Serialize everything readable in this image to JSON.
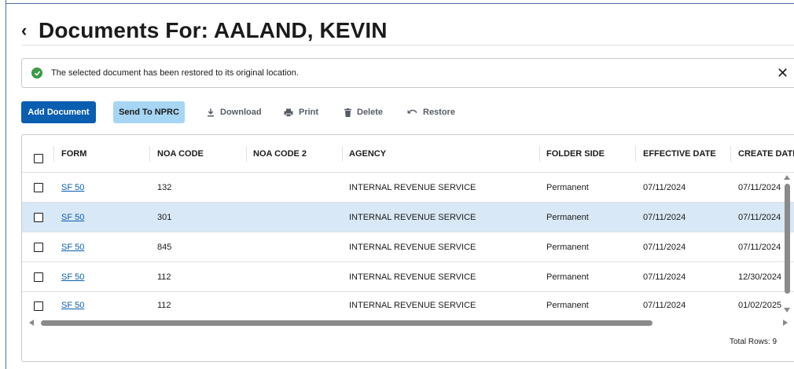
{
  "page": {
    "back_glyph": "‹",
    "title": "Documents For: AALAND, KEVIN"
  },
  "alert": {
    "message": "The selected document has been restored to its original location.",
    "close_glyph": "✕",
    "status_color": "#3a9a46"
  },
  "toolbar": {
    "add_document": "Add Document",
    "send_to_nprc": "Send To NPRC",
    "download": "Download",
    "print": "Print",
    "delete": "Delete",
    "restore": "Restore"
  },
  "table": {
    "columns": [
      "FORM",
      "NOA CODE",
      "NOA CODE 2",
      "AGENCY",
      "FOLDER SIDE",
      "EFFECTIVE DATE",
      "CREATE DATE"
    ],
    "rows": [
      {
        "form": "SF 50",
        "noa_code": "132",
        "noa_code_2": "",
        "agency": "INTERNAL REVENUE SERVICE",
        "folder_side": "Permanent",
        "effective_date": "07/11/2024",
        "create_date": "07/11/2024",
        "selected": false
      },
      {
        "form": "SF 50",
        "noa_code": "301",
        "noa_code_2": "",
        "agency": "INTERNAL REVENUE SERVICE",
        "folder_side": "Permanent",
        "effective_date": "07/11/2024",
        "create_date": "07/11/2024",
        "selected": true
      },
      {
        "form": "SF 50",
        "noa_code": "845",
        "noa_code_2": "",
        "agency": "INTERNAL REVENUE SERVICE",
        "folder_side": "Permanent",
        "effective_date": "07/11/2024",
        "create_date": "07/11/2024",
        "selected": false
      },
      {
        "form": "SF 50",
        "noa_code": "112",
        "noa_code_2": "",
        "agency": "INTERNAL REVENUE SERVICE",
        "folder_side": "Permanent",
        "effective_date": "07/11/2024",
        "create_date": "12/30/2024",
        "selected": false
      },
      {
        "form": "SF 50",
        "noa_code": "112",
        "noa_code_2": "",
        "agency": "INTERNAL REVENUE SERVICE",
        "folder_side": "Permanent",
        "effective_date": "07/11/2024",
        "create_date": "01/02/2025",
        "selected": false
      }
    ],
    "total_rows": "Total Rows: 9"
  },
  "colors": {
    "primary": "#0a5eb0",
    "secondary": "#a7d6f5",
    "selected_row": "#d9e8f6"
  },
  "icons": {
    "download": "download-icon",
    "print": "printer-icon",
    "delete": "trash-icon",
    "restore": "undo-icon",
    "success": "check-circle-icon"
  }
}
